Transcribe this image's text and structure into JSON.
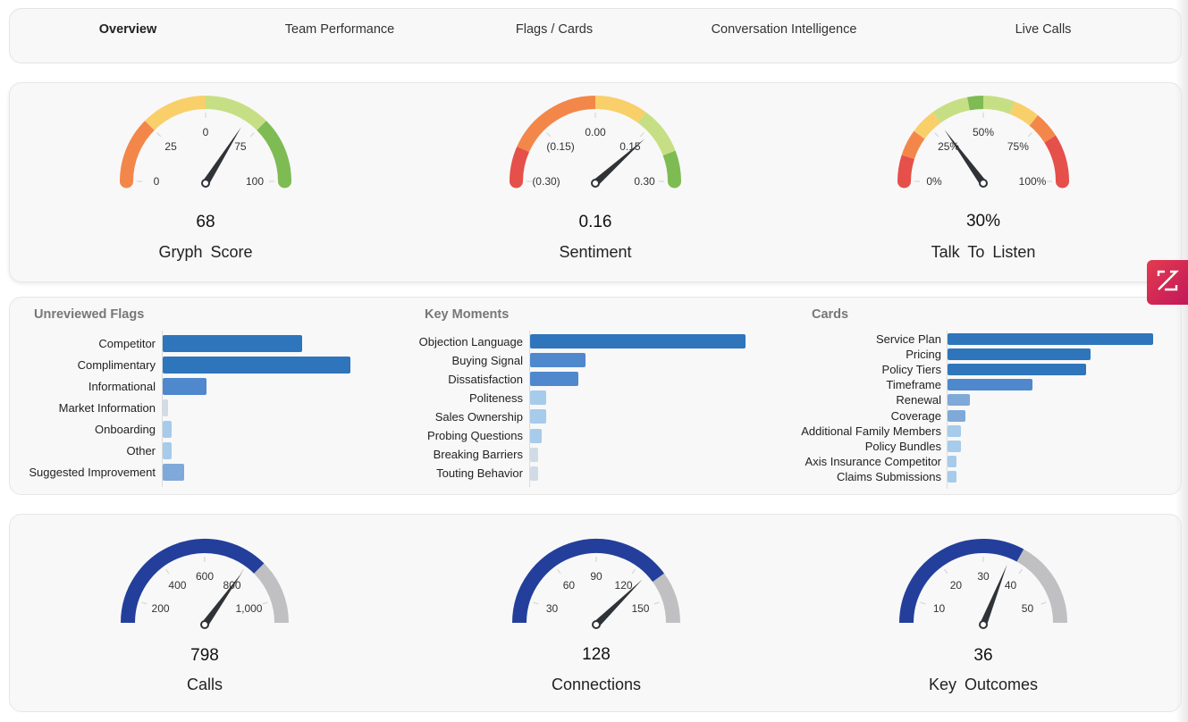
{
  "nav": {
    "tabs": [
      {
        "label": "Overview",
        "active": true
      },
      {
        "label": "Team Performance",
        "active": false
      },
      {
        "label": "Flags / Cards",
        "active": false
      },
      {
        "label": "Conversation Intelligence",
        "active": false
      },
      {
        "label": "Live Calls",
        "active": false
      }
    ]
  },
  "colors": {
    "red": "#e5504a",
    "orange": "#f3874a",
    "yellow": "#f9cf69",
    "light_green": "#c7df84",
    "green": "#7ebb53",
    "navy": "#233f9b",
    "gray": "#c0c0c2",
    "needle": "#2f3337",
    "bar_dark": "#2e75bb",
    "bar_mid": "#4f88cc",
    "bar_light": "#7fa9d8",
    "bar_pale": "#a7cbea",
    "bar_faint": "#d0dbe6",
    "badge": "#d6294f"
  },
  "chart_data": [
    {
      "type": "gauge",
      "id": "gryph-score",
      "title": "Gryph  Score",
      "value": 68,
      "value_label": "68",
      "min": 0,
      "max": 100,
      "tick_labels": [
        "0",
        "25",
        "0",
        "75",
        "100"
      ],
      "tick_values": [
        0,
        25,
        50,
        75,
        100
      ],
      "bands": [
        {
          "from": 0,
          "to": 25,
          "color": "orange"
        },
        {
          "from": 25,
          "to": 50,
          "color": "yellow"
        },
        {
          "from": 50,
          "to": 75,
          "color": "light_green"
        },
        {
          "from": 75,
          "to": 100,
          "color": "green"
        }
      ]
    },
    {
      "type": "gauge",
      "id": "sentiment",
      "title": "Sentiment",
      "value": 0.16,
      "value_label": "0.16",
      "min": -0.3,
      "max": 0.3,
      "tick_labels": [
        "(0.30)",
        "(0.15)",
        "0.00",
        "0.15",
        "0.30"
      ],
      "tick_values": [
        -0.3,
        -0.15,
        0.0,
        0.15,
        0.3
      ],
      "bands": [
        {
          "from": -0.3,
          "to": -0.22,
          "color": "red"
        },
        {
          "from": -0.22,
          "to": 0.0,
          "color": "orange"
        },
        {
          "from": 0.0,
          "to": 0.12,
          "color": "yellow"
        },
        {
          "from": 0.12,
          "to": 0.23,
          "color": "light_green"
        },
        {
          "from": 0.23,
          "to": 0.3,
          "color": "green"
        }
      ]
    },
    {
      "type": "gauge",
      "id": "talk-to-listen",
      "title": "Talk  To  Listen",
      "value": 30,
      "value_label": "30%",
      "min": 0,
      "max": 100,
      "tick_labels": [
        "0%",
        "25%",
        "50%",
        "75%",
        "100%"
      ],
      "tick_values": [
        0,
        25,
        50,
        75,
        100
      ],
      "bands": [
        {
          "from": 0,
          "to": 10,
          "color": "red"
        },
        {
          "from": 10,
          "to": 20,
          "color": "orange"
        },
        {
          "from": 20,
          "to": 30,
          "color": "yellow"
        },
        {
          "from": 30,
          "to": 44,
          "color": "light_green"
        },
        {
          "from": 44,
          "to": 50,
          "color": "green"
        },
        {
          "from": 50,
          "to": 62,
          "color": "light_green"
        },
        {
          "from": 62,
          "to": 72,
          "color": "yellow"
        },
        {
          "from": 72,
          "to": 82,
          "color": "orange"
        },
        {
          "from": 82,
          "to": 100,
          "color": "red"
        }
      ]
    },
    {
      "type": "bar",
      "id": "unreviewed-flags",
      "title": "Unreviewed Flags",
      "orientation": "horizontal",
      "categories": [
        "Competitor",
        "Complimentary",
        "Informational",
        "Market Information",
        "Onboarding",
        "Other",
        "Suggested Improvement"
      ],
      "values": [
        32,
        43,
        10,
        1,
        2,
        2,
        5
      ],
      "xlim": [
        0,
        43
      ]
    },
    {
      "type": "bar",
      "id": "key-moments",
      "title": "Key Moments",
      "orientation": "horizontal",
      "categories": [
        "Objection Language",
        "Buying Signal",
        "Dissatisfaction",
        "Politeness",
        "Sales Ownership",
        "Probing Questions",
        "Breaking Barriers",
        "Touting Behavior"
      ],
      "values": [
        54,
        14,
        12,
        4,
        4,
        3,
        2,
        2
      ],
      "xlim": [
        0,
        54
      ]
    },
    {
      "type": "bar",
      "id": "cards",
      "title": "Cards",
      "orientation": "horizontal",
      "categories": [
        "Service Plan",
        "Pricing",
        "Policy Tiers",
        "Timeframe",
        "Renewal",
        "Coverage",
        "Additional Family Members",
        "Policy Bundles",
        "Axis Insurance Competitor",
        "Claims Submissions"
      ],
      "values": [
        46,
        32,
        31,
        19,
        5,
        4,
        3,
        3,
        2,
        2
      ],
      "xlim": [
        0,
        46
      ]
    },
    {
      "type": "gauge",
      "id": "calls",
      "title": "Calls",
      "value": 798,
      "value_label": "798",
      "min": 100,
      "max": 1100,
      "tick_labels": [
        "200",
        "400",
        "600",
        "800",
        "1,000"
      ],
      "tick_values": [
        200,
        400,
        600,
        800,
        1000
      ],
      "bands": [
        {
          "from": 100,
          "to": 850,
          "color": "navy"
        },
        {
          "from": 850,
          "to": 1100,
          "color": "gray"
        }
      ]
    },
    {
      "type": "gauge",
      "id": "connections",
      "title": "Connections",
      "value": 128,
      "value_label": "128",
      "min": 15,
      "max": 165,
      "tick_labels": [
        "30",
        "60",
        "90",
        "120",
        "150"
      ],
      "tick_values": [
        30,
        60,
        90,
        120,
        150
      ],
      "bands": [
        {
          "from": 15,
          "to": 135,
          "color": "navy"
        },
        {
          "from": 135,
          "to": 165,
          "color": "gray"
        }
      ]
    },
    {
      "type": "gauge",
      "id": "key-outcomes",
      "title": "Key  Outcomes",
      "value": 36,
      "value_label": "36",
      "min": 5,
      "max": 55,
      "tick_labels": [
        "10",
        "20",
        "30",
        "40",
        "50"
      ],
      "tick_values": [
        10,
        20,
        30,
        40,
        50
      ],
      "bands": [
        {
          "from": 5,
          "to": 38,
          "color": "navy"
        },
        {
          "from": 38,
          "to": 55,
          "color": "gray"
        }
      ]
    }
  ],
  "badge": {
    "icon": "expand-z-icon"
  }
}
